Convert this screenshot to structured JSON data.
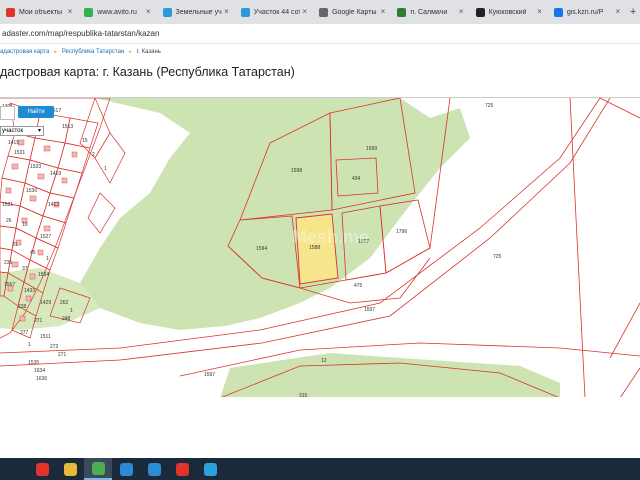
{
  "browser": {
    "tabs": [
      {
        "label": "Мои объекты",
        "color": "#e0342b"
      },
      {
        "label": "www.avito.ru",
        "color": "#31b24b"
      },
      {
        "label": "Земельные участки",
        "color": "#2c9ad6"
      },
      {
        "label": "Участок 44 сот",
        "color": "#2c9ad6"
      },
      {
        "label": "Google Карты",
        "color": "#666666"
      },
      {
        "label": "п. Салмачи",
        "color": "#2f7d32"
      },
      {
        "label": "Куюковский",
        "color": "#222222"
      },
      {
        "label": "gis.kzn.ru/P",
        "color": "#1a73e8"
      }
    ],
    "new_tab": "+",
    "close_glyph": "×",
    "url": "adaster.com/map/respublika-tatarstan/kazan"
  },
  "breadcrumb": {
    "items": [
      "адастровая карта",
      "Республика Татарстан"
    ],
    "current": "г. Казань",
    "separator": "▸"
  },
  "page": {
    "title": "дастровая карта: г. Казань (Республика Татарстан)"
  },
  "map": {
    "find_button": "Найти",
    "layer_select": "участок",
    "watermark": "Mesh.me",
    "parcels": {
      "p1598": "1598",
      "p1599": "1599",
      "p434": "434",
      "p1588": "1588",
      "p1594": "1594",
      "p1527": "1527",
      "p1796": "1796",
      "p475": "475",
      "p1597a": "1597",
      "p1597b": "1597",
      "p725a": "725",
      "p725b": "725",
      "p12": "12",
      "p315": "315"
    },
    "left_labels": [
      "1301",
      "1419",
      "1415",
      "1533",
      "1517",
      "1513",
      "15",
      "2",
      "1",
      "1531",
      "1502",
      "1530",
      "1412",
      "1521",
      "26",
      "10",
      "1527",
      "31",
      "45",
      "1",
      "236",
      "37",
      "1534",
      "1567",
      "1433",
      "1429",
      "262",
      "238",
      "1",
      "271",
      "248",
      "277",
      "1511",
      "1",
      "272",
      "271",
      "1535",
      "1634",
      "1636"
    ],
    "colors": {
      "forest": "#cde3b2",
      "parcel_line": "#d9332b",
      "selected": "#f6e58a"
    }
  },
  "taskbar": {
    "icons": [
      {
        "name": "opera-icon",
        "color": "#e0342b"
      },
      {
        "name": "file-explorer-icon",
        "color": "#e8b83a"
      },
      {
        "name": "chrome-icon",
        "color": "#4caf50"
      },
      {
        "name": "edge-icon",
        "color": "#2c8bd6"
      },
      {
        "name": "mail-icon",
        "color": "#2c8bd6"
      },
      {
        "name": "yandex-icon",
        "color": "#e0342b"
      },
      {
        "name": "telegram-icon",
        "color": "#2aa3dc"
      }
    ]
  }
}
